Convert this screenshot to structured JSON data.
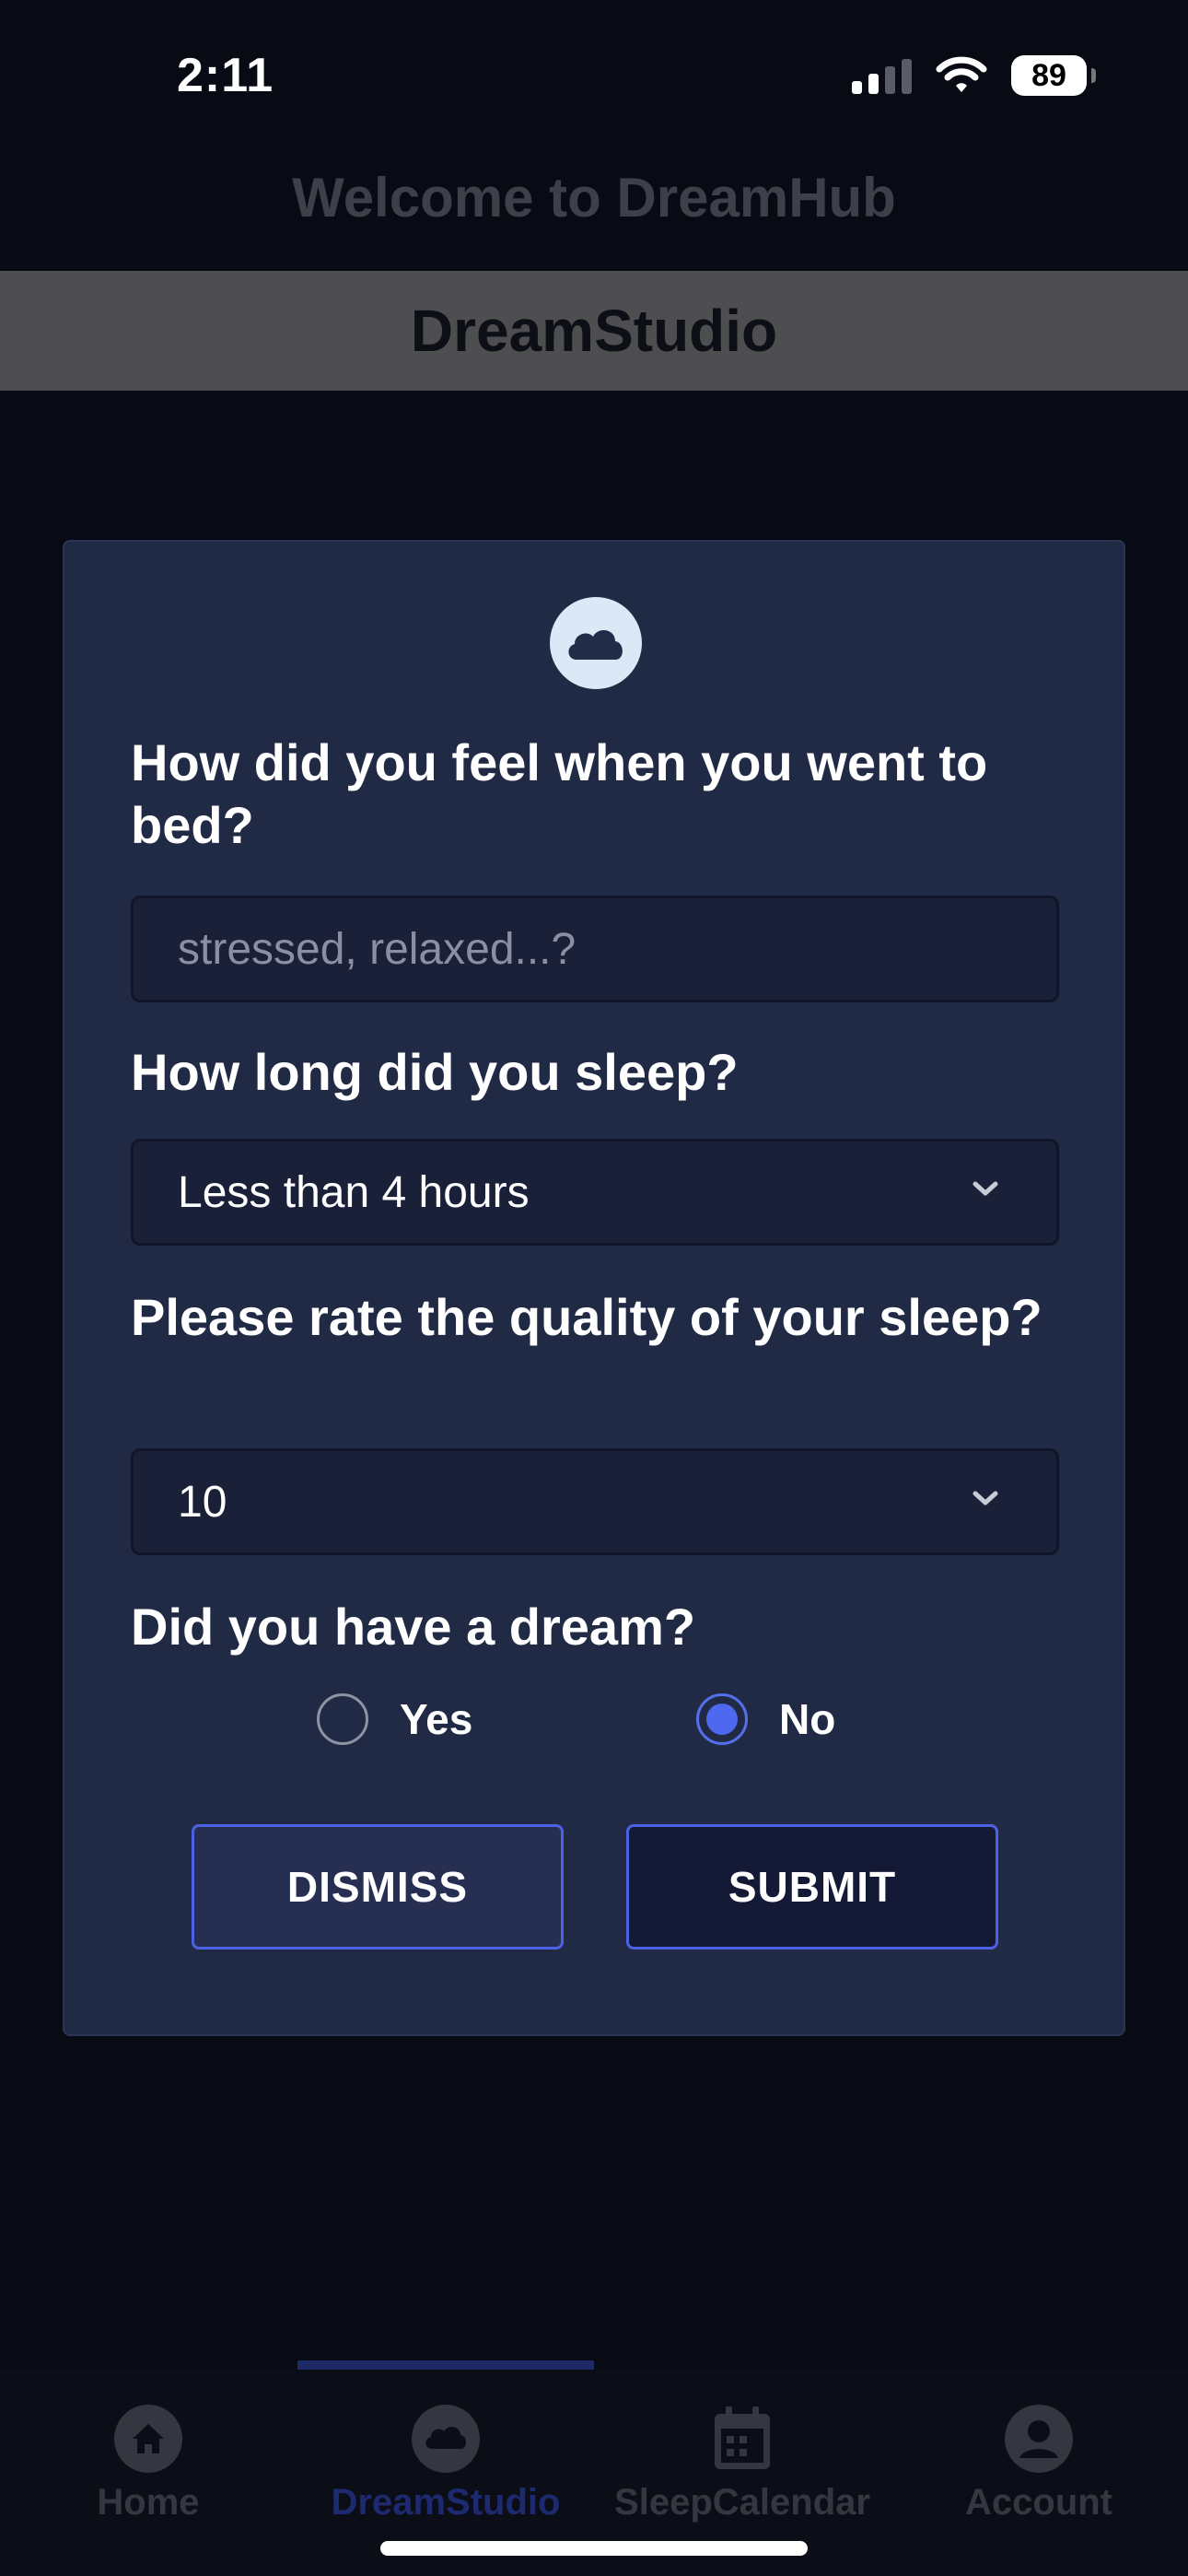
{
  "status_bar": {
    "time": "2:11",
    "battery": "89"
  },
  "header": {
    "welcome": "Welcome to DreamHub",
    "section_title": "DreamStudio"
  },
  "form": {
    "q1": "How did you feel when you went to bed?",
    "q1_placeholder": "stressed, relaxed...?",
    "q2": "How long did you sleep?",
    "q2_value": "Less than 4 hours",
    "q3": "Please rate the quality of your sleep?",
    "q3_value": "10",
    "q4": "Did you have a dream?",
    "options": [
      "Yes",
      "No"
    ],
    "selected_option": "No",
    "dismiss_label": "DISMISS",
    "submit_label": "SUBMIT"
  },
  "tabs": [
    {
      "label": "Home",
      "icon": "home-icon"
    },
    {
      "label": "DreamStudio",
      "icon": "cloud-icon",
      "active": true
    },
    {
      "label": "SleepCalendar",
      "icon": "calendar-icon"
    },
    {
      "label": "Account",
      "icon": "account-icon"
    }
  ],
  "colors": {
    "accent": "#4e68f0",
    "card": "#212a45",
    "background": "#080b14"
  }
}
